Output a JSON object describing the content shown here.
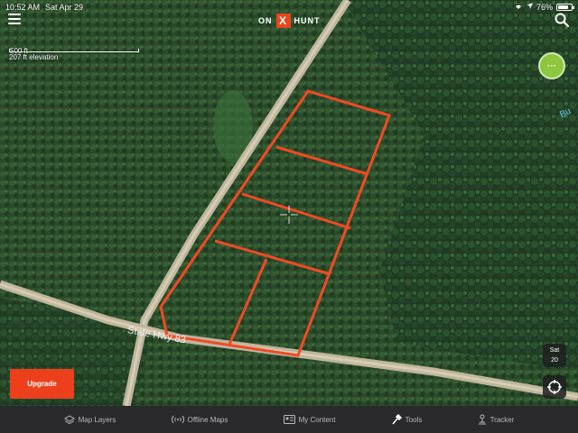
{
  "status_bar": {
    "time": "10:52 AM",
    "date": "Sat Apr 29",
    "battery": "76%",
    "battery_level": 0.76
  },
  "header": {
    "logo_left": "ON",
    "logo_mark": "X",
    "logo_right": "HUNT"
  },
  "scale": {
    "distance": "500 ft",
    "elevation": "207 ft elevation"
  },
  "fab": {
    "label": "···"
  },
  "map": {
    "road_label": "State Hwy 83",
    "water_label": "Bu",
    "road_color": "#c9bfa6",
    "boundary_color": "#f04a24"
  },
  "layer": {
    "type": "Sat",
    "zoom": "20"
  },
  "upgrade": {
    "label": "Upgrade"
  },
  "tabs": [
    {
      "label": "Map Layers",
      "icon": "map-layers-icon"
    },
    {
      "label": "Offline Maps",
      "icon": "offline-maps-icon"
    },
    {
      "label": "My Content",
      "icon": "my-content-icon"
    },
    {
      "label": "Tools",
      "icon": "tools-icon"
    },
    {
      "label": "Tracker",
      "icon": "tracker-icon"
    }
  ],
  "colors": {
    "accent": "#ec401d",
    "fab_green": "#8dc63f",
    "tab_bar": "#2a2a2c"
  }
}
